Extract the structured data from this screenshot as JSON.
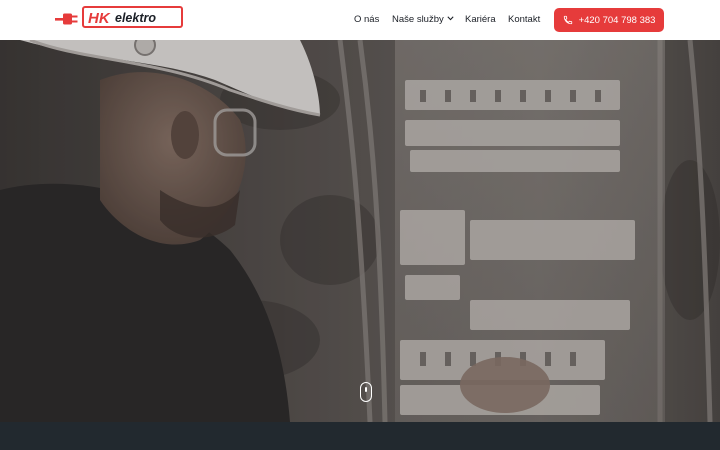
{
  "brand": {
    "logo_text_hk": "HK",
    "logo_text_rest": "elektro",
    "accent_color": "#e63b3b"
  },
  "nav": {
    "items": [
      {
        "label": "O nás"
      },
      {
        "label": "Naše služby",
        "has_dropdown": true
      },
      {
        "label": "Kariéra"
      },
      {
        "label": "Kontakt"
      }
    ],
    "phone": {
      "label": "+420 704 798 383",
      "icon": "phone-icon"
    }
  },
  "hero": {
    "image": "electrician-working-on-fuse-box",
    "scroll_icon": "mouse-scroll-icon"
  },
  "footer": {
    "color": "#22292f"
  }
}
